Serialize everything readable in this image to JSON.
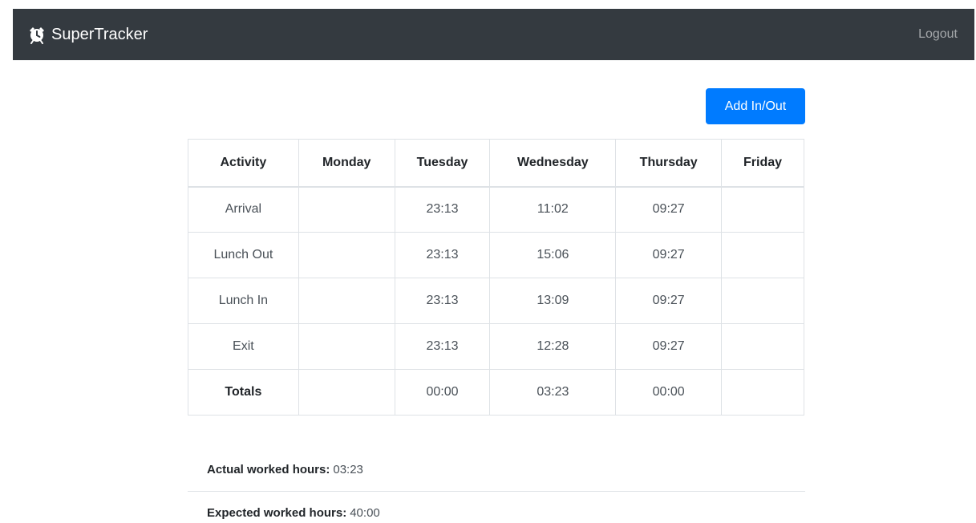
{
  "navbar": {
    "brand": "SuperTracker",
    "brand_icon": "alarm-clock-icon",
    "logout_label": "Logout",
    "background": "#343a40"
  },
  "actions": {
    "add_label": "Add In/Out",
    "accent": "#007bff"
  },
  "table": {
    "headers": [
      "Activity",
      "Monday",
      "Tuesday",
      "Wednesday",
      "Thursday",
      "Friday"
    ],
    "rows": [
      {
        "label": "Arrival",
        "cells": [
          "",
          "23:13",
          "11:02",
          "09:27",
          ""
        ]
      },
      {
        "label": "Lunch Out",
        "cells": [
          "",
          "23:13",
          "15:06",
          "09:27",
          ""
        ]
      },
      {
        "label": "Lunch In",
        "cells": [
          "",
          "23:13",
          "13:09",
          "09:27",
          ""
        ]
      },
      {
        "label": "Exit",
        "cells": [
          "",
          "23:13",
          "12:28",
          "09:27",
          ""
        ]
      },
      {
        "label": "Totals",
        "cells": [
          "",
          "00:00",
          "03:23",
          "00:00",
          ""
        ]
      }
    ]
  },
  "summary": {
    "actual_label": "Actual worked hours:",
    "actual_value": "03:23",
    "expected_label": "Expected worked hours:",
    "expected_value": "40:00"
  }
}
